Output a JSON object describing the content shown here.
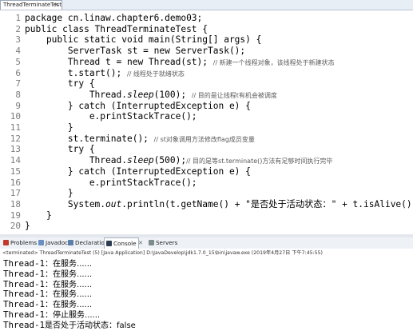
{
  "editor": {
    "tab_title": "ThreadTerminateTest.java",
    "tab_close": "✕",
    "lines": [
      {
        "num": "1",
        "parts": [
          {
            "t": "package cn.linaw.chapter6.demo03;"
          }
        ]
      },
      {
        "num": "2",
        "parts": [
          {
            "t": "public class ThreadTerminateTest {"
          }
        ]
      },
      {
        "num": "3",
        "parts": [
          {
            "t": "    public static void main(String[] args) {"
          }
        ]
      },
      {
        "num": "4",
        "parts": [
          {
            "t": "        ServerTask st = new ServerTask();"
          }
        ]
      },
      {
        "num": "5",
        "parts": [
          {
            "t": "        Thread t = new Thread(st); "
          },
          {
            "t": "// 新建一个线程对象，该线程处于新建状态",
            "c": "cm"
          }
        ]
      },
      {
        "num": "6",
        "parts": [
          {
            "t": "        t.start(); "
          },
          {
            "t": "// 线程处于就绪状态",
            "c": "cm"
          }
        ]
      },
      {
        "num": "7",
        "parts": [
          {
            "t": "        try {"
          }
        ]
      },
      {
        "num": "8",
        "parts": [
          {
            "t": "            Thread."
          },
          {
            "t": "sleep",
            "c": "it"
          },
          {
            "t": "(100); "
          },
          {
            "t": "// 目的是让线程t有机会被调度",
            "c": "cm"
          }
        ]
      },
      {
        "num": "9",
        "parts": [
          {
            "t": "        } catch (InterruptedException e) {"
          }
        ]
      },
      {
        "num": "10",
        "parts": [
          {
            "t": "            e.printStackTrace();"
          }
        ]
      },
      {
        "num": "11",
        "parts": [
          {
            "t": "        }"
          }
        ]
      },
      {
        "num": "12",
        "parts": [
          {
            "t": "        st.terminate(); "
          },
          {
            "t": "// st对象调用方法修改flag成员变量",
            "c": "cm"
          }
        ]
      },
      {
        "num": "13",
        "parts": [
          {
            "t": "        try {"
          }
        ]
      },
      {
        "num": "14",
        "parts": [
          {
            "t": "            Thread."
          },
          {
            "t": "sleep",
            "c": "it"
          },
          {
            "t": "(500);"
          },
          {
            "t": "// 目的是等st.terminate()方法有足够时间执行完毕",
            "c": "cm"
          }
        ]
      },
      {
        "num": "15",
        "parts": [
          {
            "t": "        } catch (InterruptedException e) {"
          }
        ]
      },
      {
        "num": "16",
        "parts": [
          {
            "t": "            e.printStackTrace();"
          }
        ]
      },
      {
        "num": "17",
        "parts": [
          {
            "t": "        }"
          }
        ]
      },
      {
        "num": "18",
        "parts": [
          {
            "t": "        System."
          },
          {
            "t": "out",
            "c": "it"
          },
          {
            "t": ".println(t.getName() + \"是否处于活动状态：\" + t.isAlive());"
          }
        ]
      },
      {
        "num": "19",
        "parts": [
          {
            "t": "    }"
          }
        ]
      },
      {
        "num": "20",
        "parts": [
          {
            "t": "}"
          }
        ]
      }
    ]
  },
  "panel": {
    "tabs": [
      {
        "label": "Problems",
        "icon": "problems-icon",
        "color": "#c0392b"
      },
      {
        "label": "Javadoc",
        "icon": "javadoc-icon",
        "color": "#6a8fc0"
      },
      {
        "label": "Declaration",
        "icon": "declaration-icon",
        "color": "#5a7fa8"
      },
      {
        "label": "Console",
        "icon": "console-icon",
        "color": "#2c3e50"
      },
      {
        "label": "Servers",
        "icon": "servers-icon",
        "color": "#7f8c8d"
      }
    ],
    "close_glyph": "✕",
    "terminated_text": "<terminated> ThreadTerminateTest (5) [Java Application] D:\\JavaDevelop\\jdk1.7.0_15\\bin\\javaw.exe (2019年4月27日 下午7:45:55)"
  },
  "console": {
    "lines": [
      {
        "a": "Thread-1",
        "b": "：在服务......"
      },
      {
        "a": "Thread-1",
        "b": "：在服务......"
      },
      {
        "a": "Thread-1",
        "b": "：在服务......"
      },
      {
        "a": "Thread-1",
        "b": "：在服务......"
      },
      {
        "a": "Thread-1",
        "b": "：在服务......"
      },
      {
        "a": "Thread-1",
        "b": "：停止服务......"
      },
      {
        "a": "Thread-1",
        "b": "是否处于活动状态：false"
      }
    ]
  }
}
